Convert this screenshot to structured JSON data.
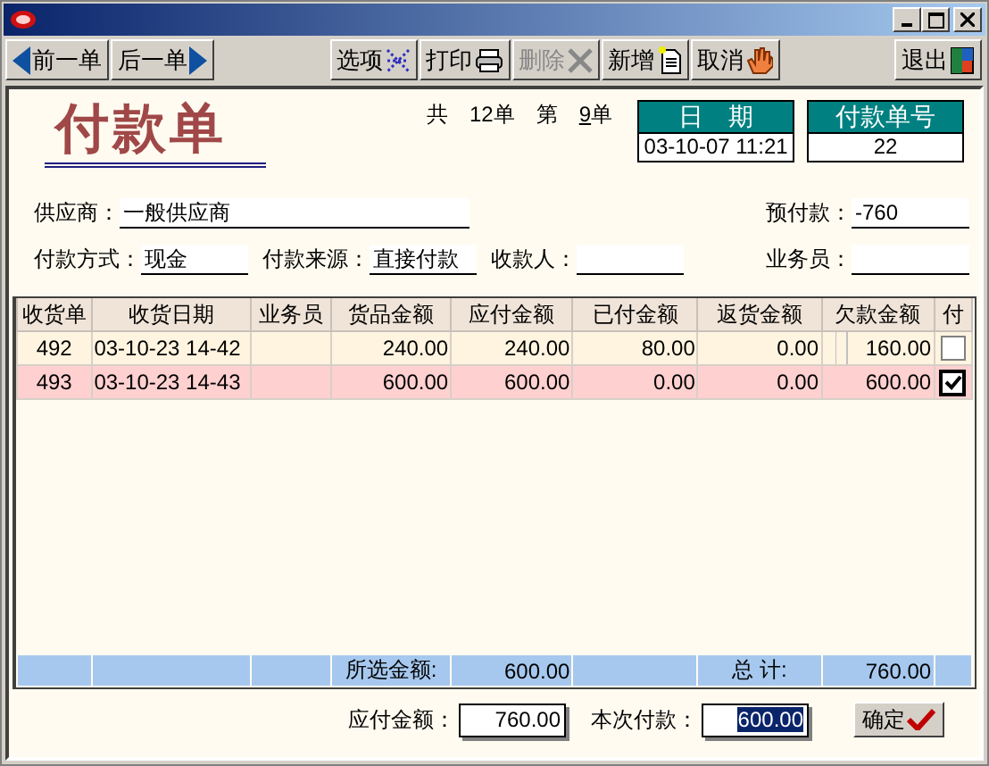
{
  "toolbar": [
    {
      "label": "前一单",
      "kind": "prev",
      "disabled": false
    },
    {
      "label": "后一单",
      "kind": "next",
      "disabled": false
    },
    {
      "label": "选项",
      "kind": "options",
      "disabled": false
    },
    {
      "label": "打印",
      "kind": "print",
      "disabled": false
    },
    {
      "label": "删除",
      "kind": "delete",
      "disabled": true
    },
    {
      "label": "新增",
      "kind": "new",
      "disabled": false
    },
    {
      "label": "取消",
      "kind": "cancel",
      "disabled": false
    },
    {
      "label": "退出",
      "kind": "exit",
      "disabled": false
    }
  ],
  "form_title": "付款单",
  "counter": {
    "total_label": "共",
    "total": "12单",
    "current_label": "第",
    "current": "9",
    "current_unit": "单"
  },
  "date": {
    "label": "日　期",
    "value": "03-10-07 11:21"
  },
  "number": {
    "label": "付款单号",
    "value": "22"
  },
  "fields_row1": [
    {
      "label": "供应商：",
      "value": "一般供应商",
      "kind": "wide"
    },
    {
      "label": "预付款：",
      "value": "-760",
      "kind": "right"
    }
  ],
  "fields_row2": [
    {
      "label": "付款方式：",
      "value": "现金",
      "kind": "short"
    },
    {
      "label": "付款来源：",
      "value": "直接付款",
      "kind": "short"
    },
    {
      "label": "收款人：",
      "kind": "short"
    },
    {
      "label": "业务员：",
      "kind": "right"
    }
  ],
  "table": {
    "columns": [
      "收货单",
      "收货日期",
      "业务员",
      "货品金额",
      "应付金额",
      "已付金额",
      "返货金额",
      "欠款金额",
      "付"
    ],
    "rows": [
      {
        "cells": [
          "492",
          "03-10-23 14-42",
          "",
          "240.00",
          "240.00",
          "80.00",
          "0.00",
          "160.00"
        ],
        "checked": false,
        "selected": false
      },
      {
        "cells": [
          "493",
          "03-10-23 14-43",
          "",
          "600.00",
          "600.00",
          "0.00",
          "0.00",
          "600.00"
        ],
        "checked": true,
        "selected": true
      }
    ],
    "totals": {
      "selected_label": "所选金额:",
      "selected_amount": "600.00",
      "total_label": "总 计:",
      "total_amount": "760.00"
    }
  },
  "payable": {
    "label": "应付金额：",
    "value": "760.00"
  },
  "payment": {
    "label": "本次付款：",
    "value": "600.00",
    "selected": true
  },
  "confirm": "确定"
}
